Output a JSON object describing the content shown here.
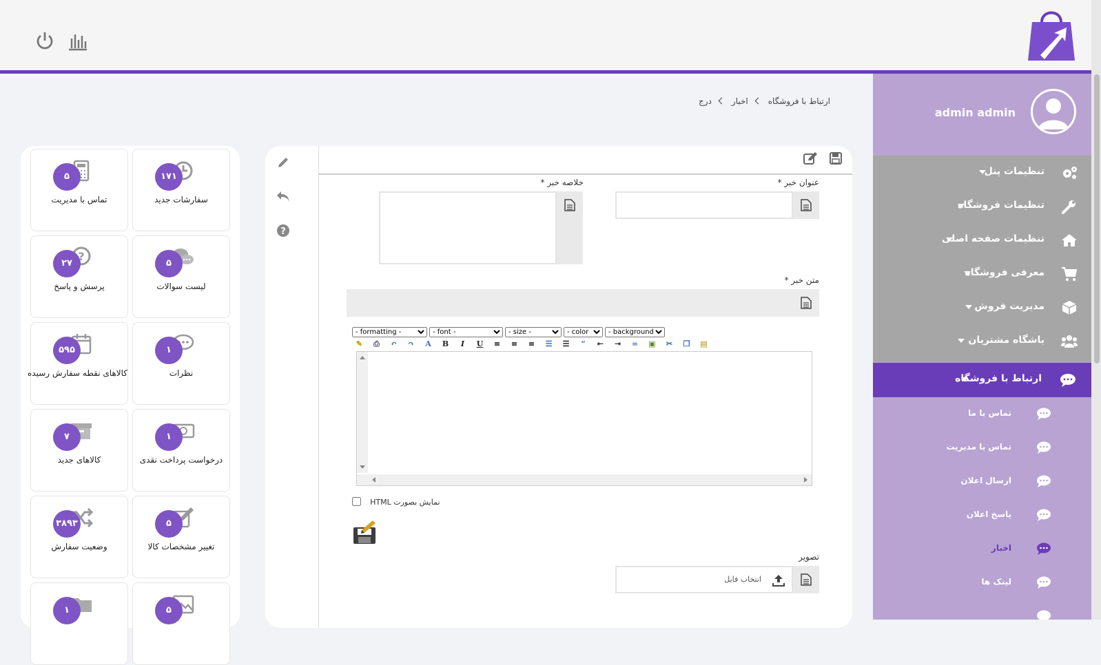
{
  "colors": {
    "accent": "#6a3db8",
    "sidebar": "#b8a3d3",
    "menu": "#a6a6a6",
    "badge": "#7f54c4"
  },
  "user": {
    "name": "admin admin"
  },
  "sidebar": {
    "items": [
      {
        "label": "تنظیمات پنل",
        "icon": "gears-icon"
      },
      {
        "label": "تنظیمات فروشگاه",
        "icon": "wrench-icon"
      },
      {
        "label": "تنظیمات صفحه اصلی",
        "icon": "home-icon"
      },
      {
        "label": "معرفی فروشگاه",
        "icon": "cart-icon"
      },
      {
        "label": "مدیریت فروش",
        "icon": "box-icon"
      },
      {
        "label": "باشگاه مشتریان",
        "icon": "users-icon"
      }
    ],
    "active": {
      "label": "ارتباط با فروشگاه",
      "icon": "comment-icon"
    },
    "sub_items": [
      {
        "label": "تماس با ما"
      },
      {
        "label": "تماس با مدیریت"
      },
      {
        "label": "ارسال اعلان"
      },
      {
        "label": "پاسخ اعلان"
      },
      {
        "label": "اخبار",
        "active": true
      },
      {
        "label": "لینک ها"
      }
    ]
  },
  "breadcrumb": {
    "level1": "ارتباط با فروشگاه",
    "level2": "اخبار",
    "level3": "درج"
  },
  "form": {
    "title_label": "عنوان خبر *",
    "summary_label": "خلاصه خبر *",
    "body_label": "متن خبر *",
    "formatting": "- formatting -",
    "font": "- font -",
    "size": "- size -",
    "color": "- color -",
    "background": "- background -",
    "html_checkbox_label": "نمایش بصورت HTML",
    "image_label": "تصویر",
    "file_placeholder": "انتخاب فایل"
  },
  "cards": [
    {
      "count": "۱۷۱",
      "label": "سفارشات جدید",
      "icon": "clock-icon"
    },
    {
      "count": "۵",
      "label": "تماس با مدیریت",
      "icon": "calculator-icon"
    },
    {
      "count": "۵",
      "label": "لیست سوالات",
      "icon": "chat-icon"
    },
    {
      "count": "۲۷",
      "label": "پرسش و پاسخ",
      "icon": "question-icon"
    },
    {
      "count": "۱",
      "label": "نظرات",
      "icon": "comment-icon"
    },
    {
      "count": "۵۹۵",
      "label": "کالاهای نقطه سفارش رسیده",
      "icon": "calendar-icon"
    },
    {
      "count": "۱",
      "label": "درخواست پرداخت نقدی",
      "icon": "money-icon"
    },
    {
      "count": "۷",
      "label": "کالاهای جدید",
      "icon": "archive-icon"
    },
    {
      "count": "۵",
      "label": "تغییر مشخصات کالا",
      "icon": "edit-icon"
    },
    {
      "count": "۳۸۹۳",
      "label": "وضعیت سفارش",
      "icon": "shuffle-icon"
    },
    {
      "count": "۵",
      "label": "",
      "icon": "image-icon"
    },
    {
      "count": "۱",
      "label": "",
      "icon": "folder-icon"
    }
  ]
}
